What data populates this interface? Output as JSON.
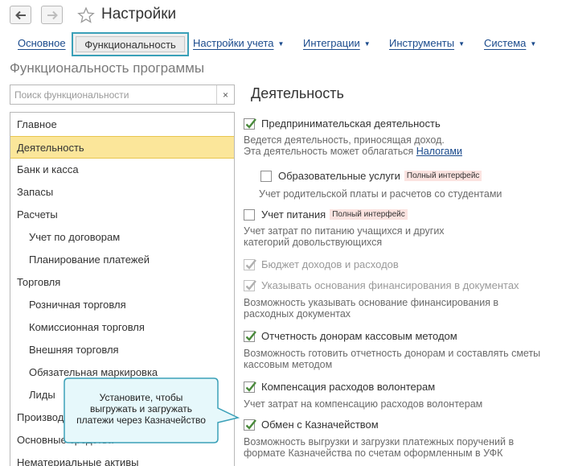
{
  "window": {
    "title": "Настройки"
  },
  "tabs": [
    {
      "label": "Основное",
      "dropdown": false
    },
    {
      "label": "Функциональность",
      "dropdown": false,
      "active": true
    },
    {
      "label": "Настройки учета",
      "dropdown": true
    },
    {
      "label": "Интеграции",
      "dropdown": true
    },
    {
      "label": "Инструменты",
      "dropdown": true
    },
    {
      "label": "Система",
      "dropdown": true
    }
  ],
  "section_title": "Функциональность программы",
  "search": {
    "placeholder": "Поиск функциональности",
    "clear": "×"
  },
  "sidebar": {
    "items": [
      {
        "label": "Главное",
        "sub": false
      },
      {
        "label": "Деятельность",
        "sub": false,
        "selected": true
      },
      {
        "label": "Банк и касса",
        "sub": false
      },
      {
        "label": "Запасы",
        "sub": false
      },
      {
        "label": "Расчеты",
        "sub": false
      },
      {
        "label": "Учет по договорам",
        "sub": true
      },
      {
        "label": "Планирование платежей",
        "sub": true
      },
      {
        "label": "Торговля",
        "sub": false
      },
      {
        "label": "Розничная торговля",
        "sub": true
      },
      {
        "label": "Комиссионная торговля",
        "sub": true
      },
      {
        "label": "Внешняя торговля",
        "sub": true
      },
      {
        "label": "Обязательная маркировка",
        "sub": true
      },
      {
        "label": "Лиды",
        "sub": true
      },
      {
        "label": "Производство",
        "sub": false
      },
      {
        "label": "Основные средства",
        "sub": false
      },
      {
        "label": "Нематериальные активы",
        "sub": false
      }
    ]
  },
  "main": {
    "title": "Деятельность",
    "options": [
      {
        "label": "Предпринимательская деятельность",
        "checked": true,
        "disabled": false
      },
      {
        "label": "Образовательные услуги",
        "checked": false,
        "disabled": false,
        "badge": "Полный интерфейс"
      },
      {
        "label": "Учет питания",
        "checked": false,
        "disabled": false,
        "badge": "Полный интерфейс"
      },
      {
        "label": "Бюджет доходов и расходов",
        "checked": true,
        "disabled": true
      },
      {
        "label": "Указывать основания финансирования в документах",
        "checked": true,
        "disabled": true
      },
      {
        "label": "Отчетность донорам кассовым методом",
        "checked": true,
        "disabled": false
      },
      {
        "label": "Компенсация расходов волонтерам",
        "checked": true,
        "disabled": false
      },
      {
        "label": "Обмен с Казначейством",
        "checked": true,
        "disabled": false
      }
    ],
    "descriptions": {
      "d0_line1": "Ведется деятельность, приносящая доход.",
      "d0_line2": "Эта деятельность может облагаться ",
      "d0_link": "Налогами",
      "d1": "Учет родительской платы и расчетов со студентами",
      "d2_line1": "Учет затрат по питанию учащихся и других",
      "d2_line2": "категорий довольствующихся",
      "d4_line1": "Возможность указывать основание финансирования в",
      "d4_line2": "расходных документах",
      "d5_line1": "Возможность готовить отчетность донорам и составлять сметы",
      "d5_line2": "кассовым методом",
      "d6": "Учет затрат на компенсацию расходов волонтерам",
      "d7_line1": "Возможность выгрузки и загрузки платежных поручений в",
      "d7_line2": "формате Казначейства по счетам оформленным в УФК"
    }
  },
  "tooltip": {
    "line1": "Установите, чтобы",
    "line2": "выгружать и загружать",
    "line3": "платежи через Казначейство"
  },
  "colors": {
    "accent": "#3aa0b8",
    "link": "#1a4a8c",
    "selected_bg": "#fbe69a",
    "badge_bg": "#fbe3e0",
    "tooltip_bg": "#e6f8fb",
    "check": "#4a8a3c"
  }
}
